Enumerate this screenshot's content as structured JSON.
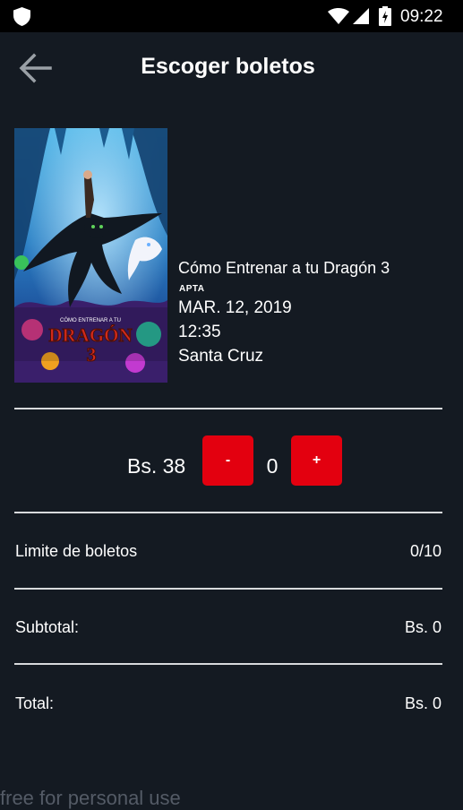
{
  "status_bar": {
    "time": "09:22"
  },
  "header": {
    "title": "Escoger boletos"
  },
  "movie": {
    "title": "Cómo Entrenar a tu Dragón 3",
    "rating": "APTA",
    "date": "MAR. 12, 2019",
    "time": "12:35",
    "venue": "Santa Cruz",
    "poster": {
      "small_caption": "CÓMO ENTRENAR A TU",
      "big_title": "DRAGÓN",
      "number": "3"
    }
  },
  "ticket": {
    "price": "Bs. 38",
    "minus_label": "-",
    "quantity": "0",
    "plus_label": "+"
  },
  "summary": {
    "limit_label": "Limite de boletos",
    "limit_value": "0/10",
    "subtotal_label": "Subtotal:",
    "subtotal_value": "Bs. 0",
    "total_label": "Total:",
    "total_value": "Bs. 0"
  },
  "watermark": "free for personal use",
  "colors": {
    "background": "#141a22",
    "accent": "#e3000f",
    "status_bar": "#000000",
    "divider": "#d8dadc"
  }
}
